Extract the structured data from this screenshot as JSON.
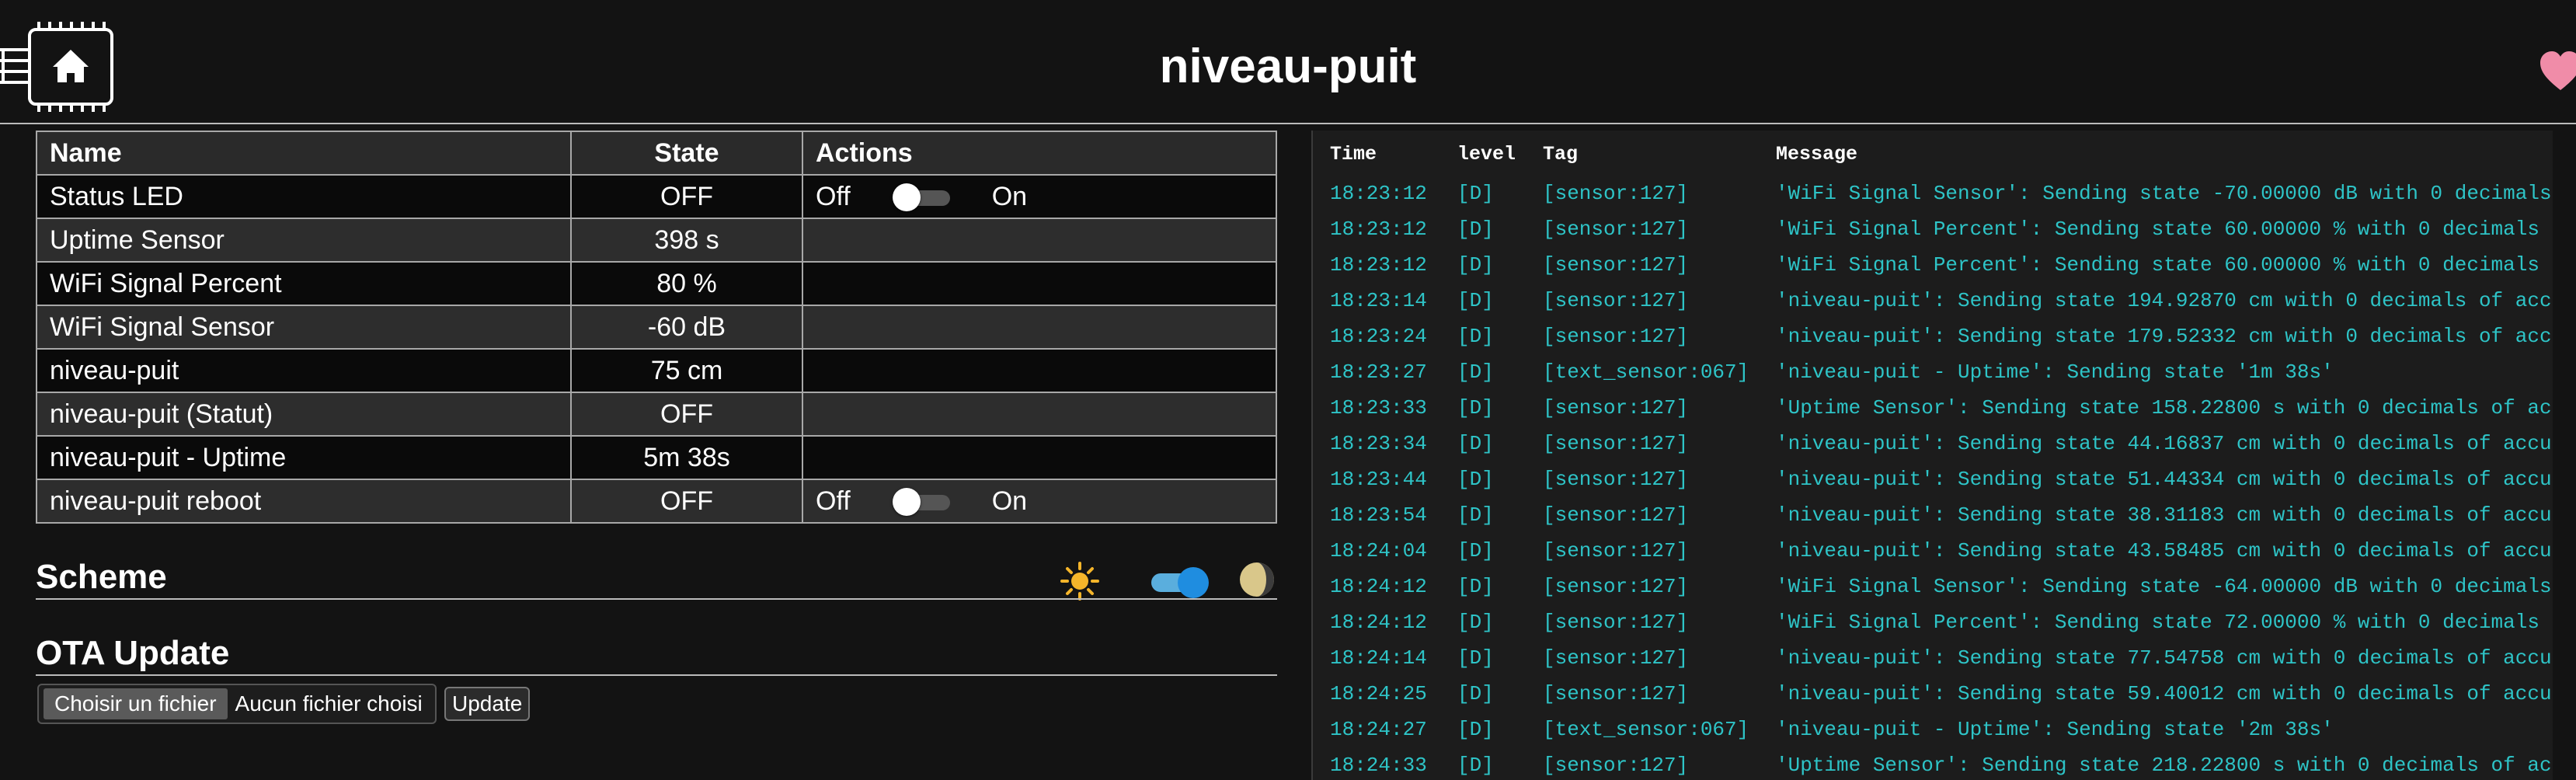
{
  "header": {
    "title": "niveau-puit"
  },
  "table": {
    "headers": {
      "name": "Name",
      "state": "State",
      "actions": "Actions"
    },
    "rows": [
      {
        "name": "Status LED",
        "state": "OFF",
        "off_label": "Off",
        "on_label": "On"
      },
      {
        "name": "Uptime Sensor",
        "state": "398 s"
      },
      {
        "name": "WiFi Signal Percent",
        "state": "80 %"
      },
      {
        "name": "WiFi Signal Sensor",
        "state": "-60 dB"
      },
      {
        "name": "niveau-puit",
        "state": "75 cm"
      },
      {
        "name": "niveau-puit (Statut)",
        "state": "OFF"
      },
      {
        "name": "niveau-puit - Uptime",
        "state": "5m 38s"
      },
      {
        "name": "niveau-puit reboot",
        "state": "OFF",
        "off_label": "Off",
        "on_label": "On"
      }
    ]
  },
  "scheme": {
    "title": "Scheme",
    "dark_mode": true
  },
  "ota": {
    "title": "OTA Update",
    "choose_label": "Choisir un fichier",
    "no_file_label": "Aucun fichier choisi",
    "update_label": "Update"
  },
  "log": {
    "headers": {
      "time": "Time",
      "level": "level",
      "tag": "Tag",
      "message": "Message"
    },
    "entries": [
      {
        "time": "18:23:12",
        "level": "[D]",
        "tag": "[sensor:127]",
        "message": "'WiFi Signal Sensor': Sending state -70.00000 dB with 0 decimals"
      },
      {
        "time": "18:23:12",
        "level": "[D]",
        "tag": "[sensor:127]",
        "message": "'WiFi Signal Percent': Sending state 60.00000 % with 0 decimals"
      },
      {
        "time": "18:23:12",
        "level": "[D]",
        "tag": "[sensor:127]",
        "message": "'WiFi Signal Percent': Sending state 60.00000 % with 0 decimals"
      },
      {
        "time": "18:23:14",
        "level": "[D]",
        "tag": "[sensor:127]",
        "message": "'niveau-puit': Sending state 194.92870 cm with 0 decimals of acc"
      },
      {
        "time": "18:23:24",
        "level": "[D]",
        "tag": "[sensor:127]",
        "message": "'niveau-puit': Sending state 179.52332 cm with 0 decimals of acc"
      },
      {
        "time": "18:23:27",
        "level": "[D]",
        "tag": "[text_sensor:067]",
        "message": "'niveau-puit - Uptime': Sending state '1m 38s'"
      },
      {
        "time": "18:23:33",
        "level": "[D]",
        "tag": "[sensor:127]",
        "message": "'Uptime Sensor': Sending state 158.22800 s with 0 decimals of ac"
      },
      {
        "time": "18:23:34",
        "level": "[D]",
        "tag": "[sensor:127]",
        "message": "'niveau-puit': Sending state 44.16837 cm with 0 decimals of accu"
      },
      {
        "time": "18:23:44",
        "level": "[D]",
        "tag": "[sensor:127]",
        "message": "'niveau-puit': Sending state 51.44334 cm with 0 decimals of accu"
      },
      {
        "time": "18:23:54",
        "level": "[D]",
        "tag": "[sensor:127]",
        "message": "'niveau-puit': Sending state 38.31183 cm with 0 decimals of accu"
      },
      {
        "time": "18:24:04",
        "level": "[D]",
        "tag": "[sensor:127]",
        "message": "'niveau-puit': Sending state 43.58485 cm with 0 decimals of accu"
      },
      {
        "time": "18:24:12",
        "level": "[D]",
        "tag": "[sensor:127]",
        "message": "'WiFi Signal Sensor': Sending state -64.00000 dB with 0 decimals"
      },
      {
        "time": "18:24:12",
        "level": "[D]",
        "tag": "[sensor:127]",
        "message": "'WiFi Signal Percent': Sending state 72.00000 % with 0 decimals"
      },
      {
        "time": "18:24:14",
        "level": "[D]",
        "tag": "[sensor:127]",
        "message": "'niveau-puit': Sending state 77.54758 cm with 0 decimals of accu"
      },
      {
        "time": "18:24:25",
        "level": "[D]",
        "tag": "[sensor:127]",
        "message": "'niveau-puit': Sending state 59.40012 cm with 0 decimals of accu"
      },
      {
        "time": "18:24:27",
        "level": "[D]",
        "tag": "[text_sensor:067]",
        "message": "'niveau-puit - Uptime': Sending state '2m 38s'"
      },
      {
        "time": "18:24:33",
        "level": "[D]",
        "tag": "[sensor:127]",
        "message": "'Uptime Sensor': Sending state 218.22800 s with 0 decimals of ac"
      }
    ]
  },
  "colors": {
    "background": "#131313",
    "log_text": "#2ec4c7",
    "toggle_on": "#1f8de0",
    "heart": "#f08ca8"
  },
  "icons": {
    "logo": "chip-home-icon",
    "heart": "heart-icon",
    "sun": "sun-icon",
    "moon": "moon-icon"
  }
}
